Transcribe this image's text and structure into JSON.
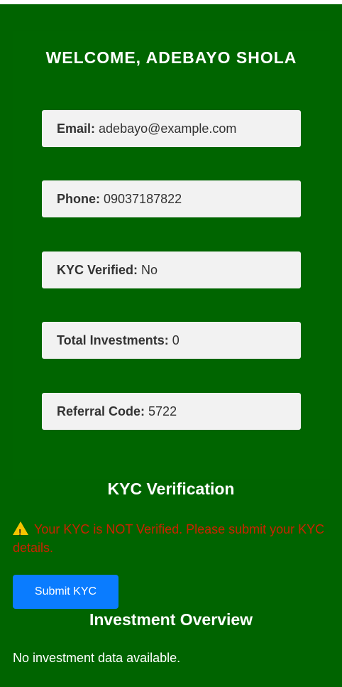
{
  "welcome": {
    "title": "WELCOME, ADEBAYO SHOLA"
  },
  "profile": {
    "email_label": "Email:",
    "email_value": "adebayo@example.com",
    "phone_label": "Phone:",
    "phone_value": "09037187822",
    "kyc_label": "KYC Verified:",
    "kyc_value": "No",
    "investments_label": "Total Investments:",
    "investments_value": "0",
    "referral_label": "Referral Code:",
    "referral_value": "5722"
  },
  "kyc": {
    "title": "KYC Verification",
    "warning_text": "Your KYC is NOT Verified. Please submit your KYC details.",
    "warning_icon": "warning-icon",
    "submit_label": "Submit KYC"
  },
  "investment": {
    "title": "Investment Overview",
    "empty_text": "No investment data available."
  },
  "colors": {
    "background": "#006400",
    "card_background": "#f2f2f2",
    "warning_text": "#cc2200",
    "button": "#0a7cff"
  }
}
